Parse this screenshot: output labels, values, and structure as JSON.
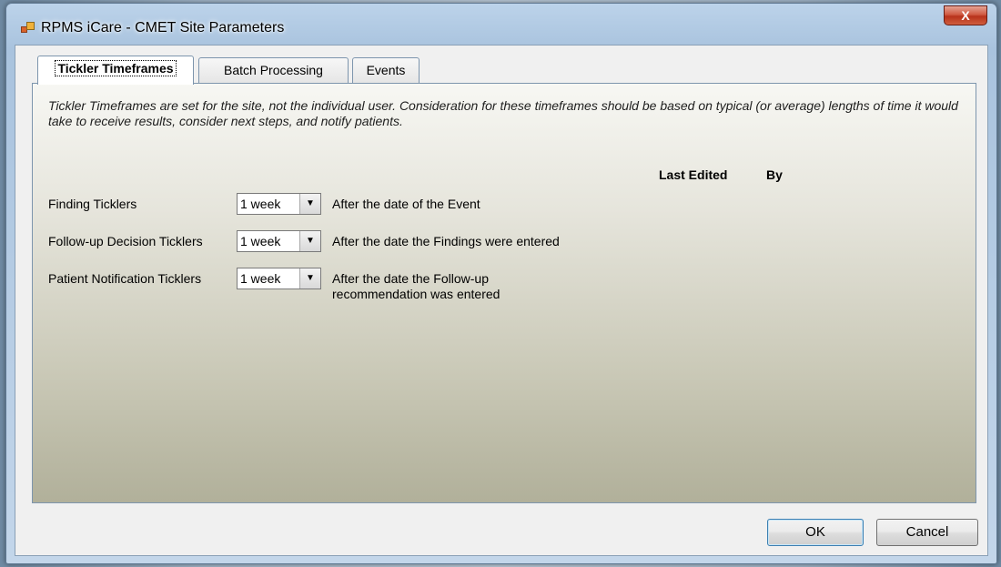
{
  "window": {
    "title": "RPMS iCare - CMET Site Parameters",
    "close_label": "X"
  },
  "tabs": [
    {
      "label": "Tickler Timeframes",
      "active": true
    },
    {
      "label": "Batch Processing",
      "active": false
    },
    {
      "label": "Events",
      "active": false
    }
  ],
  "panel": {
    "description": "Tickler Timeframes are set for the site, not the individual user.  Consideration for these timeframes should be based on typical (or average) lengths of time it would take to receive results, consider next steps, and notify patients.",
    "headers": {
      "last_edited": "Last Edited",
      "by": "By"
    },
    "rows": [
      {
        "label": "Finding Ticklers",
        "value": "1 week",
        "after": "After the date of the Event"
      },
      {
        "label": "Follow-up Decision Ticklers",
        "value": "1 week",
        "after": "After the date the Findings were entered"
      },
      {
        "label": "Patient Notification Ticklers",
        "value": "1 week",
        "after": "After the date the Follow-up recommendation was entered"
      }
    ]
  },
  "buttons": {
    "ok": "OK",
    "cancel": "Cancel"
  }
}
